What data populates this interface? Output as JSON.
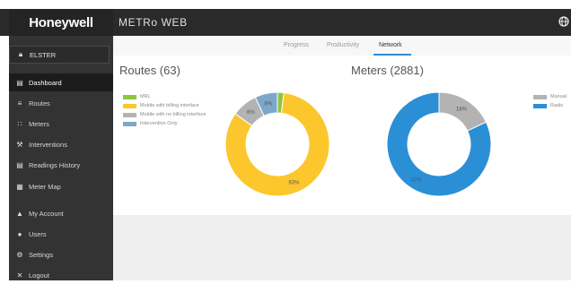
{
  "header": {
    "brand": "Honeywell",
    "app_title": "METRo WEB"
  },
  "sidebar": {
    "account": "ELSTER",
    "items": [
      {
        "label": "Dashboard",
        "icon": "dashboard-icon",
        "active": true
      },
      {
        "label": "Routes",
        "icon": "routes-icon"
      },
      {
        "label": "Meters",
        "icon": "meters-icon"
      },
      {
        "label": "Interventions",
        "icon": "interventions-icon"
      },
      {
        "label": "Readings History",
        "icon": "history-icon"
      },
      {
        "label": "Meter Map",
        "icon": "map-icon"
      },
      {
        "label": "My Account",
        "icon": "account-icon"
      },
      {
        "label": "Users",
        "icon": "users-icon"
      },
      {
        "label": "Settings",
        "icon": "settings-icon"
      },
      {
        "label": "Logout",
        "icon": "logout-icon"
      }
    ]
  },
  "tabs": [
    {
      "label": "Progress"
    },
    {
      "label": "Productivity"
    },
    {
      "label": "Network",
      "active": true
    }
  ],
  "colors": {
    "mrl": "#8dc63f",
    "with_billing": "#fcc72c",
    "with_no_billing": "#b3b3b3",
    "intervention_only": "#7da7c8",
    "manual": "#b3b3b3",
    "radio": "#2b8fd6",
    "active_tab": "#2b8fd6"
  },
  "routes": {
    "title": "Routes (63)",
    "legend": [
      {
        "label": "MRL",
        "color_key": "mrl"
      },
      {
        "label": "Mobile with billing interface",
        "color_key": "with_billing"
      },
      {
        "label": "Mobile with no billing interface",
        "color_key": "with_no_billing"
      },
      {
        "label": "Intervention Only",
        "color_key": "intervention_only"
      }
    ],
    "slices": [
      {
        "name": "MRL",
        "value": 2,
        "color_key": "mrl",
        "label": ""
      },
      {
        "name": "Mobile with billing interface",
        "value": 83,
        "color_key": "with_billing",
        "label": "83%"
      },
      {
        "name": "Mobile with no billing interface",
        "value": 8,
        "color_key": "with_no_billing",
        "label": "8%"
      },
      {
        "name": "Intervention Only",
        "value": 7,
        "color_key": "intervention_only",
        "label": "8%"
      }
    ]
  },
  "meters": {
    "title": "Meters (2881)",
    "legend": [
      {
        "label": "Manual",
        "color_key": "manual"
      },
      {
        "label": "Radio",
        "color_key": "radio"
      }
    ],
    "slices": [
      {
        "name": "Manual",
        "value": 18,
        "color_key": "manual",
        "label": "18%"
      },
      {
        "name": "Radio",
        "value": 82,
        "color_key": "radio",
        "label": "82%"
      }
    ]
  }
}
